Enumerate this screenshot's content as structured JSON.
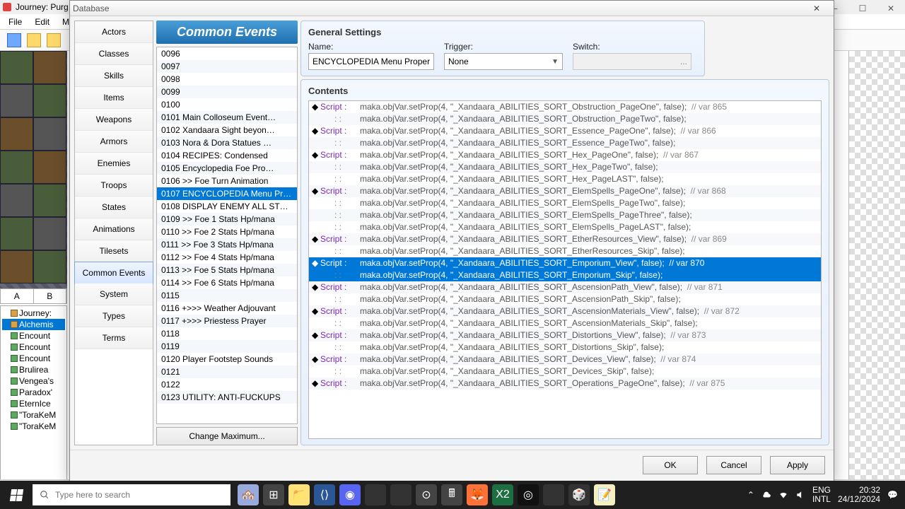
{
  "outer": {
    "title": "Journey: Purg…",
    "menus": [
      "File",
      "Edit",
      "M"
    ],
    "tabs": {
      "a": "A",
      "b": "B"
    },
    "tree": [
      {
        "label": "Journey:",
        "icon": "folder",
        "sel": false
      },
      {
        "label": "Alchemis",
        "icon": "folder",
        "sel": true
      },
      {
        "label": "Encount",
        "icon": "map",
        "sel": false
      },
      {
        "label": "Encount",
        "icon": "map",
        "sel": false
      },
      {
        "label": "Encount",
        "icon": "map",
        "sel": false
      },
      {
        "label": "Brulirea",
        "icon": "map",
        "sel": false
      },
      {
        "label": "Vengea's",
        "icon": "map",
        "sel": false
      },
      {
        "label": "Paradox'",
        "icon": "map",
        "sel": false
      },
      {
        "label": "EternIce",
        "icon": "map",
        "sel": false
      },
      {
        "label": "\"ToraKeM",
        "icon": "map",
        "sel": false
      },
      {
        "label": "\"ToraKeM",
        "icon": "map",
        "sel": false
      }
    ]
  },
  "dialog": {
    "title": "Database",
    "categories": [
      "Actors",
      "Classes",
      "Skills",
      "Items",
      "Weapons",
      "Armors",
      "Enemies",
      "Troops",
      "States",
      "Animations",
      "Tilesets",
      "Common Events",
      "System",
      "Types",
      "Terms"
    ],
    "category_selected": 11,
    "header": "Common Events",
    "change_max": "Change Maximum...",
    "buttons": {
      "ok": "OK",
      "cancel": "Cancel",
      "apply": "Apply"
    },
    "list": [
      {
        "n": "0096",
        "t": ""
      },
      {
        "n": "0097",
        "t": ""
      },
      {
        "n": "0098",
        "t": ""
      },
      {
        "n": "0099",
        "t": ""
      },
      {
        "n": "0100",
        "t": ""
      },
      {
        "n": "0101",
        "t": "Main Colloseum Event…"
      },
      {
        "n": "0102",
        "t": "Xandaara Sight beyon…"
      },
      {
        "n": "0103",
        "t": "Nora & Dora Statues …"
      },
      {
        "n": "0104",
        "t": "RECIPES: Condensed"
      },
      {
        "n": "0105",
        "t": "Encyclopedia Foe Pro…"
      },
      {
        "n": "0106",
        "t": ">> Foe Turn Animation"
      },
      {
        "n": "0107",
        "t": "ENCYCLOPEDIA Menu Pr…",
        "sel": true
      },
      {
        "n": "0108",
        "t": "DISPLAY ENEMY ALL ST…"
      },
      {
        "n": "0109",
        "t": ">> Foe 1 Stats Hp/mana"
      },
      {
        "n": "0110",
        "t": ">> Foe 2 Stats Hp/mana"
      },
      {
        "n": "0111",
        "t": ">> Foe 3 Stats Hp/mana"
      },
      {
        "n": "0112",
        "t": ">> Foe 4 Stats Hp/mana"
      },
      {
        "n": "0113",
        "t": ">> Foe 5 Stats Hp/mana"
      },
      {
        "n": "0114",
        "t": ">> Foe 6 Stats Hp/mana"
      },
      {
        "n": "0115",
        "t": ""
      },
      {
        "n": "0116",
        "t": "+>>> Weather Adjouvant"
      },
      {
        "n": "0117",
        "t": "+>>> Priestess Prayer"
      },
      {
        "n": "0118",
        "t": ""
      },
      {
        "n": "0119",
        "t": ""
      },
      {
        "n": "0120",
        "t": "Player Footstep Sounds"
      },
      {
        "n": "0121",
        "t": ""
      },
      {
        "n": "0122",
        "t": ""
      },
      {
        "n": "0123",
        "t": "UTILITY: ANTI-FUCKUPS"
      }
    ],
    "gs": {
      "title": "General Settings",
      "name_label": "Name:",
      "name_value": "ENCYCLOPEDIA Menu Properti",
      "trigger_label": "Trigger:",
      "trigger_value": "None",
      "switch_label": "Switch:",
      "switch_value": "",
      "switch_btn": "..."
    },
    "contents": {
      "title": "Contents",
      "lines": [
        {
          "k": "Script",
          "c": "maka.objVar.setProp(4, \"_Xandaara_ABILITIES_SORT_Obstruction_PageOne\", false);",
          "m": "  // var 865"
        },
        {
          "k": ":",
          "c": "maka.objVar.setProp(4, \"_Xandaara_ABILITIES_SORT_Obstruction_PageTwo\", false);",
          "m": ""
        },
        {
          "k": "Script",
          "c": "maka.objVar.setProp(4, \"_Xandaara_ABILITIES_SORT_Essence_PageOne\", false);",
          "m": "  // var 866"
        },
        {
          "k": ":",
          "c": "maka.objVar.setProp(4, \"_Xandaara_ABILITIES_SORT_Essence_PageTwo\", false);",
          "m": ""
        },
        {
          "k": "Script",
          "c": "maka.objVar.setProp(4, \"_Xandaara_ABILITIES_SORT_Hex_PageOne\", false);",
          "m": "  // var 867"
        },
        {
          "k": ":",
          "c": "maka.objVar.setProp(4, \"_Xandaara_ABILITIES_SORT_Hex_PageTwo\", false);",
          "m": ""
        },
        {
          "k": ":",
          "c": "maka.objVar.setProp(4, \"_Xandaara_ABILITIES_SORT_Hex_PageLAST\", false);",
          "m": ""
        },
        {
          "k": "Script",
          "c": "maka.objVar.setProp(4, \"_Xandaara_ABILITIES_SORT_ElemSpells_PageOne\", false);",
          "m": "  // var 868"
        },
        {
          "k": ":",
          "c": "maka.objVar.setProp(4, \"_Xandaara_ABILITIES_SORT_ElemSpells_PageTwo\", false);",
          "m": ""
        },
        {
          "k": ":",
          "c": "maka.objVar.setProp(4, \"_Xandaara_ABILITIES_SORT_ElemSpells_PageThree\", false);",
          "m": ""
        },
        {
          "k": ":",
          "c": "maka.objVar.setProp(4, \"_Xandaara_ABILITIES_SORT_ElemSpells_PageLAST\", false);",
          "m": ""
        },
        {
          "k": "Script",
          "c": "maka.objVar.setProp(4, \"_Xandaara_ABILITIES_SORT_EtherResources_View\", false);",
          "m": "  // var 869"
        },
        {
          "k": ":",
          "c": "maka.objVar.setProp(4, \"_Xandaara_ABILITIES_SORT_EtherResources_Skip\", false);",
          "m": ""
        },
        {
          "k": "Script",
          "c": "maka.objVar.setProp(4, \"_Xandaara_ABILITIES_SORT_Emporium_View\", false);",
          "m": "  // var 870",
          "sel": true
        },
        {
          "k": ":",
          "c": "maka.objVar.setProp(4, \"_Xandaara_ABILITIES_SORT_Emporium_Skip\", false);",
          "m": "",
          "sel": true
        },
        {
          "k": "Script",
          "c": "maka.objVar.setProp(4, \"_Xandaara_ABILITIES_SORT_AscensionPath_View\", false);",
          "m": "  // var 871"
        },
        {
          "k": ":",
          "c": "maka.objVar.setProp(4, \"_Xandaara_ABILITIES_SORT_AscensionPath_Skip\", false);",
          "m": ""
        },
        {
          "k": "Script",
          "c": "maka.objVar.setProp(4, \"_Xandaara_ABILITIES_SORT_AscensionMaterials_View\", false);",
          "m": "  // var 872"
        },
        {
          "k": ":",
          "c": "maka.objVar.setProp(4, \"_Xandaara_ABILITIES_SORT_AscensionMaterials_Skip\", false);",
          "m": ""
        },
        {
          "k": "Script",
          "c": "maka.objVar.setProp(4, \"_Xandaara_ABILITIES_SORT_Distortions_View\", false);",
          "m": "  // var 873"
        },
        {
          "k": ":",
          "c": "maka.objVar.setProp(4, \"_Xandaara_ABILITIES_SORT_Distortions_Skip\", false);",
          "m": ""
        },
        {
          "k": "Script",
          "c": "maka.objVar.setProp(4, \"_Xandaara_ABILITIES_SORT_Devices_View\", false);",
          "m": "  // var 874"
        },
        {
          "k": ":",
          "c": "maka.objVar.setProp(4, \"_Xandaara_ABILITIES_SORT_Devices_Skip\", false);",
          "m": ""
        },
        {
          "k": "Script",
          "c": "maka.objVar.setProp(4, \"_Xandaara_ABILITIES_SORT_Operations_PageOne\", false);",
          "m": "  // var 875"
        }
      ]
    }
  },
  "taskbar": {
    "search_placeholder": "Type here to search",
    "lang": "ENG",
    "locale": "INTL",
    "time": "20:32",
    "date": "24/12/2024"
  }
}
